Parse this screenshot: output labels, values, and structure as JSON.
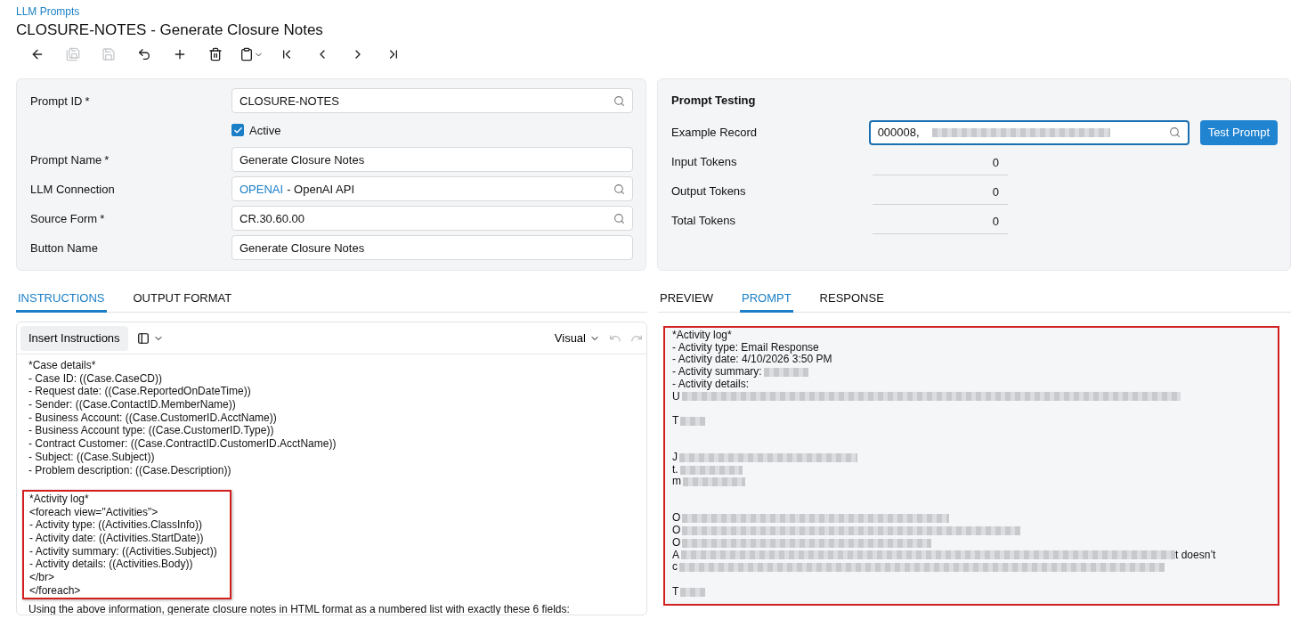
{
  "breadcrumb": "LLM Prompts",
  "title": "CLOSURE-NOTES - Generate Closure Notes",
  "toolbar": [
    {
      "kind": "back",
      "disabled": false
    },
    {
      "kind": "save-close",
      "disabled": true
    },
    {
      "kind": "save",
      "disabled": true
    },
    {
      "kind": "cancel",
      "disabled": false
    },
    {
      "kind": "add",
      "disabled": false
    },
    {
      "kind": "delete",
      "disabled": false
    },
    {
      "kind": "copy",
      "disabled": false
    },
    {
      "kind": "first",
      "disabled": false
    },
    {
      "kind": "prev",
      "disabled": false
    },
    {
      "kind": "next",
      "disabled": false
    },
    {
      "kind": "last",
      "disabled": false
    }
  ],
  "form": [
    {
      "kind": "lookup",
      "label": "Prompt ID",
      "required_mark": "*",
      "value": "CLOSURE-NOTES"
    },
    {
      "kind": "checkbox",
      "label": "Active",
      "checked": true
    },
    {
      "kind": "text",
      "label": "Prompt Name",
      "required_mark": "*",
      "value": "Generate Closure Notes"
    },
    {
      "kind": "lookup",
      "label": "LLM Connection",
      "link": "OPENAI",
      "value": " - OpenAI API"
    },
    {
      "kind": "lookup",
      "label": "Source Form",
      "required_mark": "*",
      "value": "CR.30.60.00"
    },
    {
      "kind": "text",
      "label": "Button Name",
      "value": "Generate Closure Notes"
    }
  ],
  "testing": {
    "title": "Prompt Testing",
    "example_label": "Example Record",
    "example_value": "000008,",
    "button": "Test Prompt",
    "tokens": [
      {
        "label": "Input Tokens",
        "value": "0"
      },
      {
        "label": "Output Tokens",
        "value": "0"
      },
      {
        "label": "Total Tokens",
        "value": "0"
      }
    ]
  },
  "left_tabs": [
    {
      "label": "INSTRUCTIONS",
      "selected": true
    },
    {
      "label": "OUTPUT FORMAT",
      "selected": false
    }
  ],
  "editor": {
    "insert_button": "Insert Instructions",
    "mode": "Visual",
    "lines": [
      {
        "kind": "text",
        "text": "*Case details*"
      },
      {
        "kind": "text",
        "text": "- Case ID: ((Case.CaseCD))"
      },
      {
        "kind": "text",
        "text": "- Request date: ((Case.ReportedOnDateTime))"
      },
      {
        "kind": "text",
        "text": "- Sender: ((Case.ContactID.MemberName))"
      },
      {
        "kind": "text",
        "text": "- Business Account: ((Case.CustomerID.AcctName))"
      },
      {
        "kind": "text",
        "text": "- Business Account type: ((Case.CustomerID.Type))"
      },
      {
        "kind": "text",
        "text": "- Contract Customer: ((Case.ContractID.CustomerID.AcctName))"
      },
      {
        "kind": "text",
        "text": "- Subject: ((Case.Subject))"
      },
      {
        "kind": "text",
        "text": "- Problem description: ((Case.Description))"
      },
      {
        "kind": "blank"
      }
    ],
    "highlight": [
      "*Activity log*",
      "<foreach view=\"Activities\">",
      "- Activity type: ((Activities.ClassInfo))",
      "- Activity date: ((Activities.StartDate))",
      "- Activity summary: ((Activities.Subject))",
      "- Activity details: ((Activities.Body))",
      "</br>",
      "</foreach>"
    ],
    "after": "Using the above information, generate closure notes in HTML format as a numbered list with exactly these 6 fields:"
  },
  "right_tabs": [
    {
      "label": "PREVIEW",
      "selected": false
    },
    {
      "label": "PROMPT",
      "selected": true
    },
    {
      "label": "RESPONSE",
      "selected": false
    }
  ],
  "prompt_lines": [
    {
      "text": "*Activity log*",
      "redacted": false
    },
    {
      "text": "- Activity type: Email Response",
      "redacted": false
    },
    {
      "text": "- Activity date: 4/10/2026 3:50 PM",
      "redacted": false
    },
    {
      "text": "- Activity summary:",
      "redacted": true
    },
    {
      "text": "- Activity details:",
      "redacted": false
    },
    {
      "text": "U",
      "redacted": true
    },
    {
      "redacted": false
    },
    {
      "text": "T",
      "redacted": true
    },
    {
      "redacted": false
    },
    {
      "redacted": false
    },
    {
      "text": "J",
      "redacted": true
    },
    {
      "text": "t.",
      "redacted": true
    },
    {
      "text": "m",
      "redacted": true
    },
    {
      "redacted": false
    },
    {
      "redacted": false
    },
    {
      "text": "O",
      "redacted": true
    },
    {
      "text": "O",
      "redacted": true
    },
    {
      "text": "O",
      "redacted": true
    },
    {
      "text": "A",
      "redacted": true,
      "tail": "t doesn’t"
    },
    {
      "text": "c",
      "redacted": true
    },
    {
      "redacted": false
    },
    {
      "text": "T",
      "redacted": true
    }
  ]
}
